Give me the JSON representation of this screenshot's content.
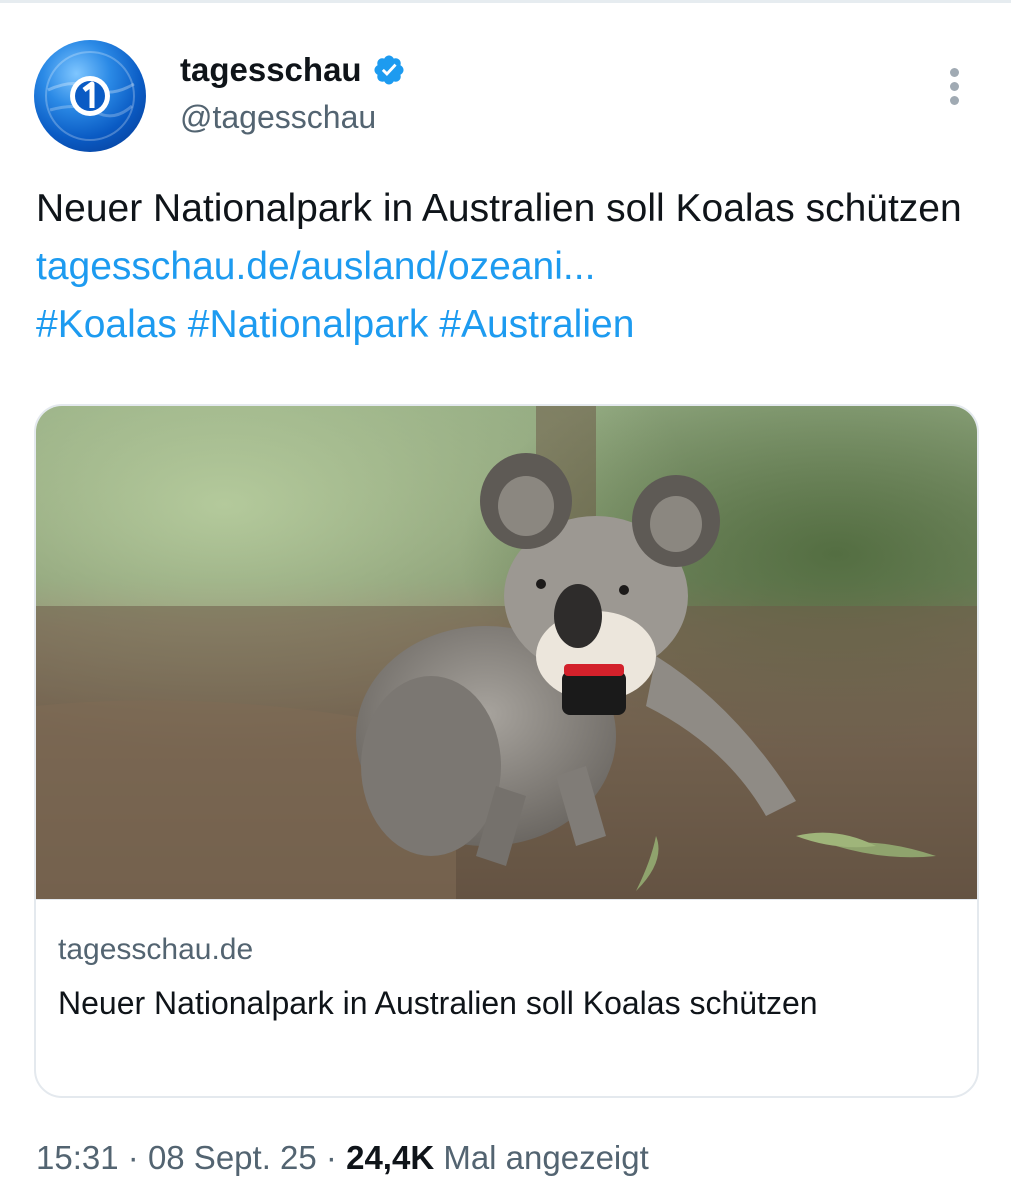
{
  "author": {
    "name": "tagesschau",
    "handle": "@tagesschau",
    "verified": true
  },
  "icons": {
    "avatar": "tagesschau-logo",
    "verified": "verified-badge-icon",
    "more": "more-vertical-icon"
  },
  "tweet": {
    "text": "Neuer Nationalpark in Australien soll Koalas schützen",
    "link": "tagesschau.de/ausland/ozeani...",
    "hashtags": [
      "#Koalas",
      "#Nationalpark",
      "#Australien"
    ]
  },
  "card": {
    "domain": "tagesschau.de",
    "title": "Neuer Nationalpark in Australien soll Koalas schützen",
    "image": "koala-photo"
  },
  "meta": {
    "time": "15:31",
    "date": "08 Sept. 25",
    "views": "24,4K",
    "views_label": "Mal angezeigt",
    "separator": "·"
  },
  "colors": {
    "link": "#1d9bf0",
    "secondary_text": "#536471",
    "verified": "#1d9bf0",
    "avatar_blue": "#0a5bc4"
  }
}
